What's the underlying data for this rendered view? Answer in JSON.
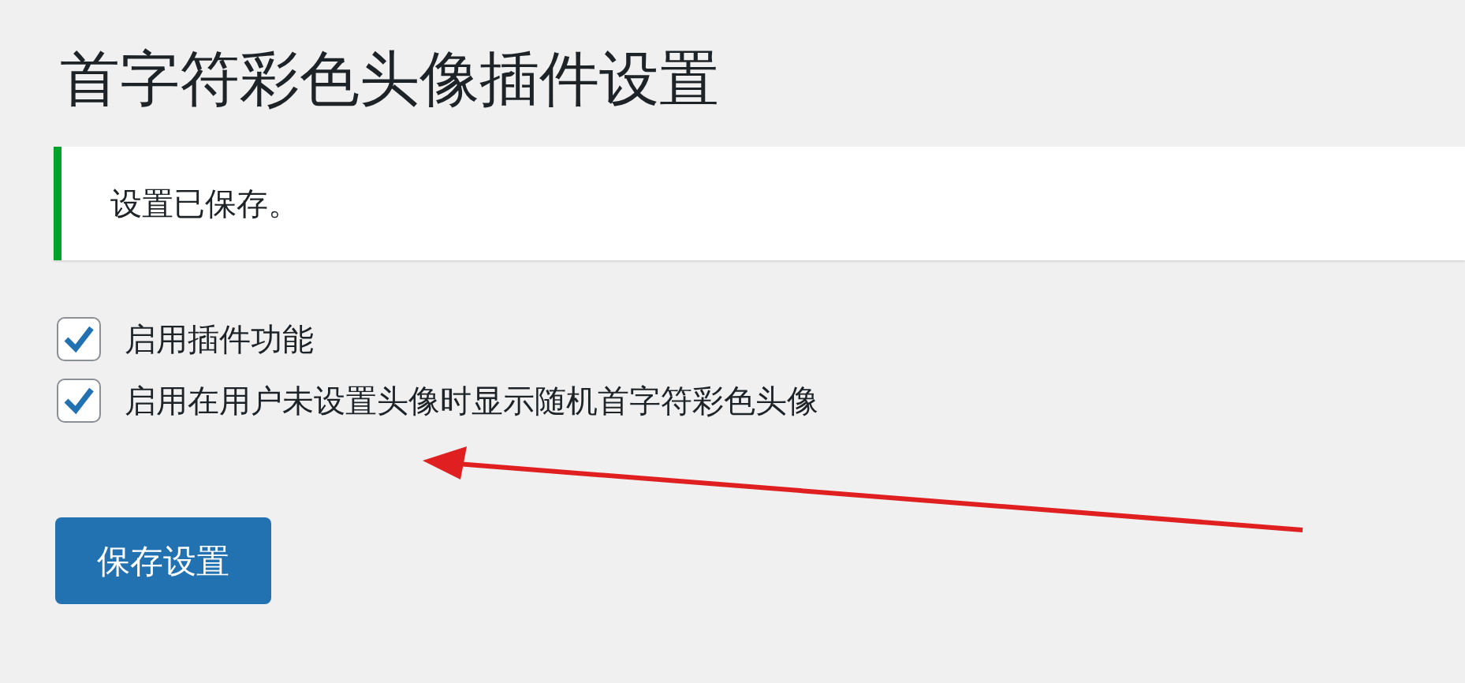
{
  "title": "首字符彩色头像插件设置",
  "notice": {
    "text": "设置已保存。"
  },
  "options": [
    {
      "label": "启用插件功能",
      "checked": true
    },
    {
      "label": "启用在用户未设置头像时显示随机首字符彩色头像",
      "checked": true
    }
  ],
  "save_button": "保存设置"
}
